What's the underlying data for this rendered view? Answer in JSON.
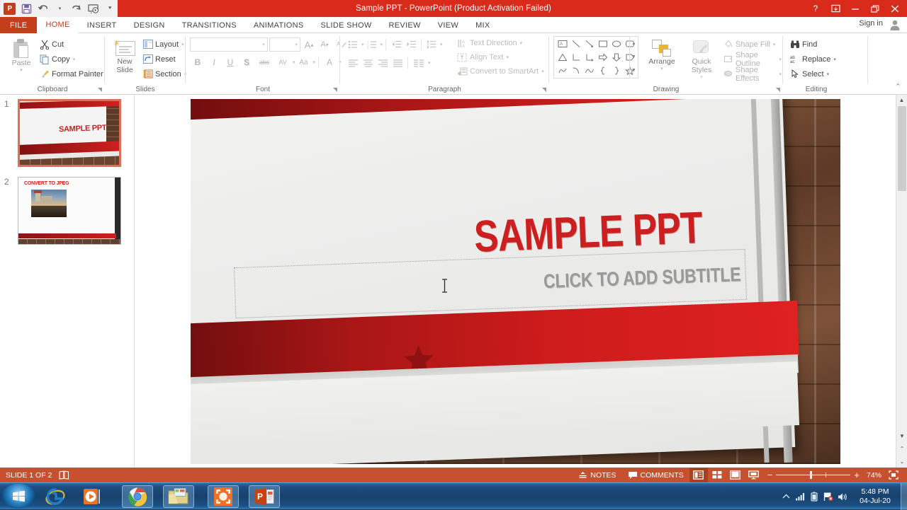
{
  "window": {
    "title": "Sample PPT -  PowerPoint (Product Activation Failed)",
    "help_label": "?",
    "ribbon_options_label": "⊞",
    "minimize_label": "—",
    "restore_label": "❐",
    "close_label": "✕",
    "signin_label": "Sign in"
  },
  "quick_access": {
    "app_logo": "P",
    "items": [
      {
        "name": "save-icon",
        "glyph": "🖫"
      },
      {
        "name": "undo-icon",
        "glyph": "↶"
      },
      {
        "name": "redo-icon",
        "glyph": "↺"
      },
      {
        "name": "start-slideshow-icon",
        "glyph": "▷"
      },
      {
        "name": "customize-qat-icon",
        "glyph": "▾"
      }
    ]
  },
  "tabs": [
    {
      "label": "FILE",
      "id": "file"
    },
    {
      "label": "HOME",
      "id": "home"
    },
    {
      "label": "INSERT",
      "id": "insert"
    },
    {
      "label": "DESIGN",
      "id": "design"
    },
    {
      "label": "TRANSITIONS",
      "id": "transitions"
    },
    {
      "label": "ANIMATIONS",
      "id": "animations"
    },
    {
      "label": "SLIDE SHOW",
      "id": "slideshow"
    },
    {
      "label": "REVIEW",
      "id": "review"
    },
    {
      "label": "VIEW",
      "id": "view"
    },
    {
      "label": "MIX",
      "id": "mix"
    }
  ],
  "ribbon": {
    "clipboard": {
      "label": "Clipboard",
      "paste": "Paste",
      "cut": "Cut",
      "copy": "Copy",
      "format_painter": "Format Painter"
    },
    "slides": {
      "label": "Slides",
      "new_slide": "New",
      "new_slide2": "Slide",
      "layout": "Layout",
      "reset": "Reset",
      "section": "Section"
    },
    "font": {
      "label": "Font",
      "font_name_value": "",
      "font_size_value": "",
      "grow_font": "A",
      "shrink_font": "A",
      "clear_formatting": "✎",
      "bold": "B",
      "italic": "I",
      "underline": "U",
      "shadow": "S",
      "strikethrough": "abc",
      "character_spacing": "AV",
      "change_case": "Aa",
      "font_color": "A"
    },
    "paragraph": {
      "label": "Paragraph",
      "text_direction": "Text Direction",
      "align_text": "Align Text",
      "convert_smartart": "Convert to SmartArt"
    },
    "drawing": {
      "label": "Drawing",
      "arrange": "Arrange",
      "quick_styles": "Quick",
      "quick_styles2": "Styles",
      "shape_fill": "Shape Fill",
      "shape_outline": "Shape Outline",
      "shape_effects": "Shape Effects",
      "shapes": [
        "▭A",
        "╲",
        "↘",
        "▭",
        "◯",
        "▢",
        "△",
        "⌐",
        "⌐↦",
        "⇨",
        "⇩",
        "◲",
        "✎",
        "◜",
        "∿",
        "{",
        "}",
        "☆"
      ]
    },
    "editing": {
      "label": "Editing",
      "find": "Find",
      "replace": "Replace",
      "select": "Select",
      "collapse": "⌃"
    }
  },
  "thumbnails": [
    {
      "number": "1",
      "title": "SAMPLE PPT",
      "selected": true
    },
    {
      "number": "2",
      "title": "CONVERT TO JPEG",
      "selected": false
    }
  ],
  "slide": {
    "title": "SAMPLE PPT",
    "subtitle_placeholder": "CLICK TO ADD SUBTITLE",
    "title_color": "#cc1f1f",
    "band_color": "#d41f1f",
    "subtitle_color": "#9a9a9a"
  },
  "status_bar": {
    "slide_indicator": "SLIDE 1 OF 2",
    "notes_icon": "notes-page-icon",
    "notes": "NOTES",
    "comments": "COMMENTS",
    "views": [
      {
        "name": "normal-view",
        "glyph": "▤",
        "active": true
      },
      {
        "name": "slide-sorter-view",
        "glyph": "▦",
        "active": false
      },
      {
        "name": "reading-view",
        "glyph": "📖",
        "active": false
      },
      {
        "name": "slideshow-view",
        "glyph": "⎙",
        "active": false
      }
    ],
    "zoom_out": "−",
    "zoom_in": "+",
    "zoom_level": "74%",
    "fit_to_window": "⛶"
  },
  "taskbar": {
    "start": "start-orb",
    "apps": [
      {
        "name": "internet-explorer-icon",
        "open": false
      },
      {
        "name": "windows-media-player-icon",
        "open": false
      },
      {
        "name": "google-chrome-icon",
        "open": true
      },
      {
        "name": "windows-explorer-icon",
        "open": true
      },
      {
        "name": "screen-recorder-icon",
        "open": true
      },
      {
        "name": "powerpoint-icon",
        "open": true
      }
    ],
    "tray": [
      {
        "name": "show-hidden-icons",
        "glyph": "▲"
      },
      {
        "name": "network-icon",
        "glyph": "▮"
      },
      {
        "name": "battery-icon",
        "glyph": "▯"
      },
      {
        "name": "flag-action-center-icon",
        "glyph": "⚑"
      },
      {
        "name": "volume-icon",
        "glyph": "🔊"
      }
    ],
    "time": "5:48 PM",
    "date": "04-Jul-20"
  }
}
